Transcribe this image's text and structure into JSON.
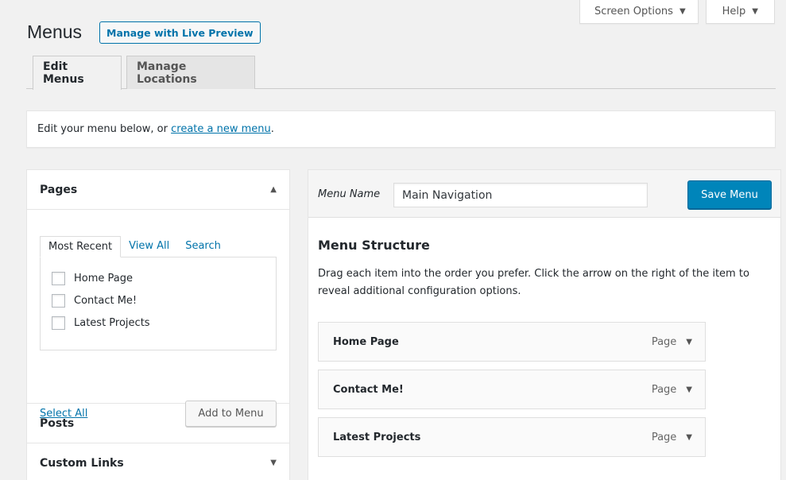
{
  "top_tabs": {
    "screen_options": "Screen Options",
    "help": "Help",
    "caret": "▼"
  },
  "page": {
    "title": "Menus",
    "live_preview_button": "Manage with Live Preview"
  },
  "nav_tabs": [
    {
      "label": "Edit Menus",
      "active": true
    },
    {
      "label": "Manage Locations",
      "active": false
    }
  ],
  "notice": {
    "prefix": "Edit your menu below, or ",
    "link": "create a new menu",
    "suffix": "."
  },
  "sidebar": {
    "sections": [
      {
        "title": "Pages",
        "arrow": "▲",
        "expanded": true
      },
      {
        "title": "Posts",
        "arrow": "▼",
        "expanded": false
      },
      {
        "title": "Custom Links",
        "arrow": "▼",
        "expanded": false
      }
    ],
    "pages_tabs": [
      "Most Recent",
      "View All",
      "Search"
    ],
    "pages_items": [
      "Home Page",
      "Contact Me!",
      "Latest Projects"
    ],
    "select_all": "Select All",
    "add_to_menu": "Add to Menu"
  },
  "editor": {
    "menu_name_label": "Menu Name",
    "menu_name_value": "Main Navigation",
    "save_button": "Save Menu",
    "structure_title": "Menu Structure",
    "structure_description": "Drag each item into the order you prefer. Click the arrow on the right of the item to reveal additional configuration options.",
    "items": [
      {
        "title": "Home Page",
        "type": "Page"
      },
      {
        "title": "Contact Me!",
        "type": "Page"
      },
      {
        "title": "Latest Projects",
        "type": "Page"
      }
    ]
  },
  "colors": {
    "primary_button": "#0085ba",
    "link": "#0073aa",
    "background": "#f1f1f1"
  }
}
